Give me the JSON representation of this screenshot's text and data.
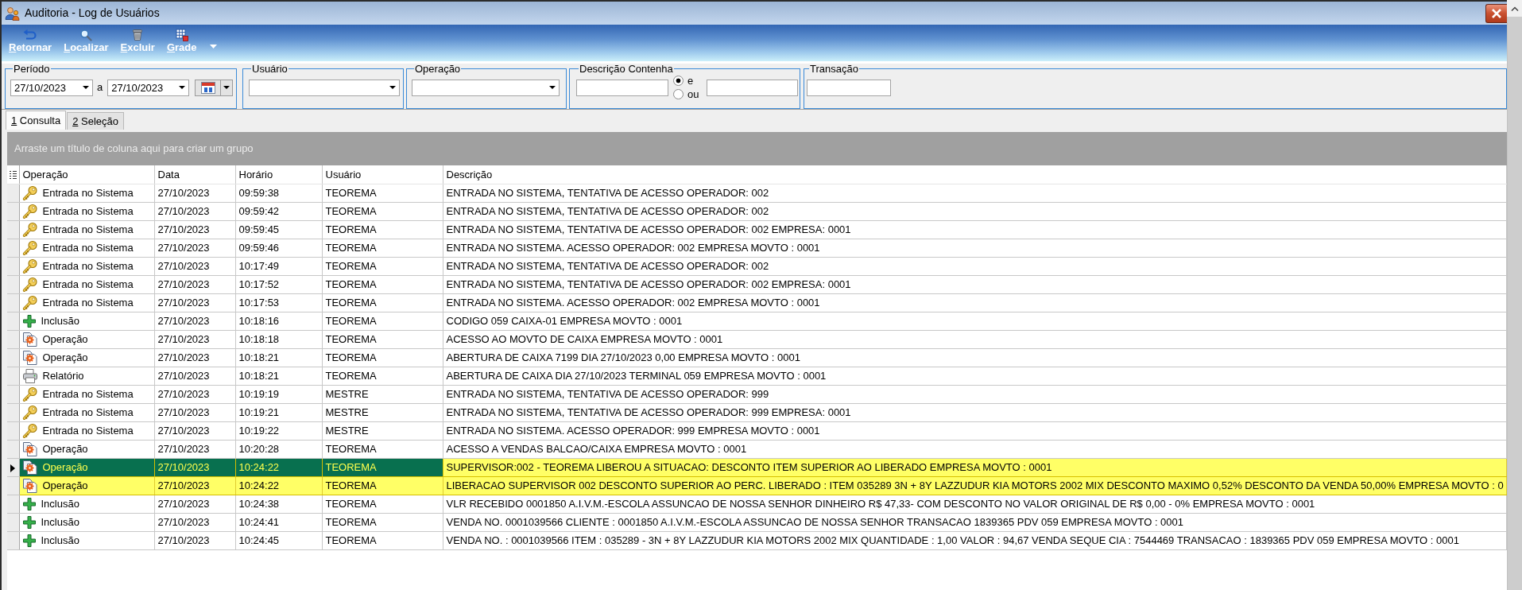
{
  "window": {
    "title": "Auditoria - Log de Usuários"
  },
  "toolbar": [
    {
      "label": "Retornar",
      "kind": "back"
    },
    {
      "label": "Localizar",
      "kind": "search"
    },
    {
      "label": "Excluir",
      "kind": "delete"
    },
    {
      "label": "Grade",
      "kind": "grid"
    }
  ],
  "filters": [
    {
      "kind": "period",
      "label": "Período",
      "from": "27/10/2023",
      "separator": "a",
      "to": "27/10/2023"
    },
    {
      "kind": "combo",
      "label": "Usuário"
    },
    {
      "kind": "combo",
      "label": "Operação"
    },
    {
      "kind": "text_pair",
      "label": "Descrição Contenha",
      "options": [
        {
          "label": "e",
          "selected": true
        },
        {
          "label": "ou",
          "selected": false
        }
      ]
    },
    {
      "kind": "text",
      "label": "Transação"
    }
  ],
  "tabs": [
    {
      "label": "1 Consulta",
      "selected": true
    },
    {
      "label": "2 Seleção",
      "selected": false
    }
  ],
  "grid": {
    "group_hint": "Arraste um título de coluna aqui para criar um grupo",
    "columns": [
      {
        "label": "Operação",
        "focused": false
      },
      {
        "label": "Data",
        "focused": false
      },
      {
        "label": "Horário",
        "focused": false
      },
      {
        "label": "Usuário",
        "focused": false
      },
      {
        "label": "Descrição",
        "focused": true
      }
    ],
    "rows": [
      {
        "kind": "login",
        "operation": "Entrada no Sistema",
        "date": "27/10/2023",
        "time": "09:59:38",
        "user": "TEOREMA",
        "description": "ENTRADA NO SISTEMA, TENTATIVA DE ACESSO OPERADOR: 002",
        "selected": false,
        "current": false
      },
      {
        "kind": "login",
        "operation": "Entrada no Sistema",
        "date": "27/10/2023",
        "time": "09:59:42",
        "user": "TEOREMA",
        "description": "ENTRADA NO SISTEMA, TENTATIVA DE ACESSO OPERADOR: 002",
        "selected": false,
        "current": false
      },
      {
        "kind": "login",
        "operation": "Entrada no Sistema",
        "date": "27/10/2023",
        "time": "09:59:45",
        "user": "TEOREMA",
        "description": "ENTRADA NO SISTEMA, TENTATIVA DE ACESSO OPERADOR: 002 EMPRESA: 0001",
        "selected": false,
        "current": false
      },
      {
        "kind": "login",
        "operation": "Entrada no Sistema",
        "date": "27/10/2023",
        "time": "09:59:46",
        "user": "TEOREMA",
        "description": "ENTRADA NO SISTEMA. ACESSO OPERADOR: 002 EMPRESA MOVTO : 0001",
        "selected": false,
        "current": false
      },
      {
        "kind": "login",
        "operation": "Entrada no Sistema",
        "date": "27/10/2023",
        "time": "10:17:49",
        "user": "TEOREMA",
        "description": "ENTRADA NO SISTEMA, TENTATIVA DE ACESSO OPERADOR: 002",
        "selected": false,
        "current": false
      },
      {
        "kind": "login",
        "operation": "Entrada no Sistema",
        "date": "27/10/2023",
        "time": "10:17:52",
        "user": "TEOREMA",
        "description": "ENTRADA NO SISTEMA, TENTATIVA DE ACESSO OPERADOR: 002 EMPRESA: 0001",
        "selected": false,
        "current": false
      },
      {
        "kind": "login",
        "operation": "Entrada no Sistema",
        "date": "27/10/2023",
        "time": "10:17:53",
        "user": "TEOREMA",
        "description": "ENTRADA NO SISTEMA. ACESSO OPERADOR: 002 EMPRESA MOVTO : 0001",
        "selected": false,
        "current": false
      },
      {
        "kind": "insert",
        "operation": "Inclusão",
        "date": "27/10/2023",
        "time": "10:18:16",
        "user": "TEOREMA",
        "description": "CODIGO 059 CAIXA-01 EMPRESA MOVTO : 0001",
        "selected": false,
        "current": false
      },
      {
        "kind": "operation",
        "operation": "Operação",
        "date": "27/10/2023",
        "time": "10:18:18",
        "user": "TEOREMA",
        "description": "ACESSO AO MOVTO DE CAIXA EMPRESA MOVTO : 0001",
        "selected": false,
        "current": false
      },
      {
        "kind": "operation",
        "operation": "Operação",
        "date": "27/10/2023",
        "time": "10:18:21",
        "user": "TEOREMA",
        "description": "ABERTURA DE CAIXA 7199 DIA 27/10/2023 0,00 EMPRESA MOVTO : 0001",
        "selected": false,
        "current": false
      },
      {
        "kind": "report",
        "operation": "Relatório",
        "date": "27/10/2023",
        "time": "10:18:21",
        "user": "TEOREMA",
        "description": "ABERTURA DE CAIXA DIA 27/10/2023 TERMINAL 059 EMPRESA MOVTO : 0001",
        "selected": false,
        "current": false
      },
      {
        "kind": "login",
        "operation": "Entrada no Sistema",
        "date": "27/10/2023",
        "time": "10:19:19",
        "user": "MESTRE",
        "description": "ENTRADA NO SISTEMA, TENTATIVA DE ACESSO OPERADOR: 999",
        "selected": false,
        "current": false
      },
      {
        "kind": "login",
        "operation": "Entrada no Sistema",
        "date": "27/10/2023",
        "time": "10:19:21",
        "user": "MESTRE",
        "description": "ENTRADA NO SISTEMA, TENTATIVA DE ACESSO OPERADOR: 999 EMPRESA: 0001",
        "selected": false,
        "current": false
      },
      {
        "kind": "login",
        "operation": "Entrada no Sistema",
        "date": "27/10/2023",
        "time": "10:19:22",
        "user": "MESTRE",
        "description": "ENTRADA NO SISTEMA. ACESSO OPERADOR: 999 EMPRESA MOVTO : 0001",
        "selected": false,
        "current": false
      },
      {
        "kind": "operation",
        "operation": "Operação",
        "date": "27/10/2023",
        "time": "10:20:28",
        "user": "TEOREMA",
        "description": "ACESSO A VENDAS BALCAO/CAIXA EMPRESA MOVTO : 0001",
        "selected": false,
        "current": false
      },
      {
        "kind": "operation",
        "operation": "Operação",
        "date": "27/10/2023",
        "time": "10:24:22",
        "user": "TEOREMA",
        "description": "SUPERVISOR:002 - TEOREMA LIBEROU A SITUACAO: DESCONTO ITEM SUPERIOR AO LIBERADO EMPRESA MOVTO : 0001",
        "selected": true,
        "current": true
      },
      {
        "kind": "operation",
        "operation": "Operação",
        "date": "27/10/2023",
        "time": "10:24:22",
        "user": "TEOREMA",
        "description": "LIBERACAO SUPERVISOR 002 DESCONTO SUPERIOR AO PERC. LIBERADO : ITEM 035289 3N + 8Y LAZZUDUR KIA MOTORS 2002 MIX DESCONTO MAXIMO 0,52% DESCONTO DA VENDA 50,00% EMPRESA MOVTO : 0",
        "selected": true,
        "current": false
      },
      {
        "kind": "insert",
        "operation": "Inclusão",
        "date": "27/10/2023",
        "time": "10:24:38",
        "user": "TEOREMA",
        "description": "VLR RECEBIDO 0001850 A.I.V.M.-ESCOLA ASSUNCAO DE NOSSA SENHOR DINHEIRO R$ 47,33- COM DESCONTO NO VALOR ORIGINAL DE R$ 0,00 - 0% EMPRESA MOVTO : 0001",
        "selected": false,
        "current": false
      },
      {
        "kind": "insert",
        "operation": "Inclusão",
        "date": "27/10/2023",
        "time": "10:24:41",
        "user": "TEOREMA",
        "description": "VENDA NO. 0001039566 CLIENTE : 0001850 A.I.V.M.-ESCOLA ASSUNCAO DE NOSSA SENHOR TRANSACAO 1839365 PDV 059 EMPRESA MOVTO : 0001",
        "selected": false,
        "current": false
      },
      {
        "kind": "insert",
        "operation": "Inclusão",
        "date": "27/10/2023",
        "time": "10:24:45",
        "user": "TEOREMA",
        "description": "VENDA NO. : 0001039566 ITEM : 035289 - 3N + 8Y LAZZUDUR KIA MOTORS 2002 MIX QUANTIDADE : 1,00 VALOR : 94,67 VENDA SEQUE CIA : 7544469 TRANSACAO : 1839365 PDV 059 EMPRESA MOVTO : 0001",
        "selected": false,
        "current": false
      }
    ]
  }
}
